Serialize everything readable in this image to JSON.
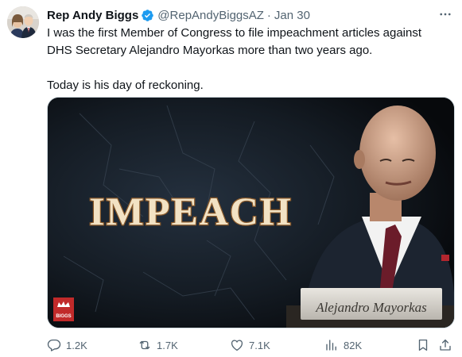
{
  "tweet": {
    "author_name": "Rep Andy Biggs",
    "handle": "@RepAndyBiggsAZ",
    "separator": "·",
    "date": "Jan 30",
    "paragraphs": [
      "I was the first Member of Congress to file impeachment articles against DHS Secretary Alejandro Mayorkas more than two years ago.",
      "Today is his day of reckoning."
    ]
  },
  "media": {
    "headline": "IMPEACH",
    "nameplate": "Alejandro Mayorkas",
    "logo_text": "BIGGS"
  },
  "actions": {
    "replies": "1.2K",
    "reposts": "1.7K",
    "likes": "7.1K",
    "views": "82K"
  },
  "colors": {
    "verified": "#1d9bf0",
    "muted_text": "#536471",
    "headline_fill": "#f2e2c4",
    "headline_outline": "#8a5a2b"
  },
  "icons": [
    "verified-badge-icon",
    "more-icon",
    "reply-icon",
    "repost-icon",
    "like-icon",
    "views-icon",
    "bookmark-icon",
    "share-icon"
  ]
}
